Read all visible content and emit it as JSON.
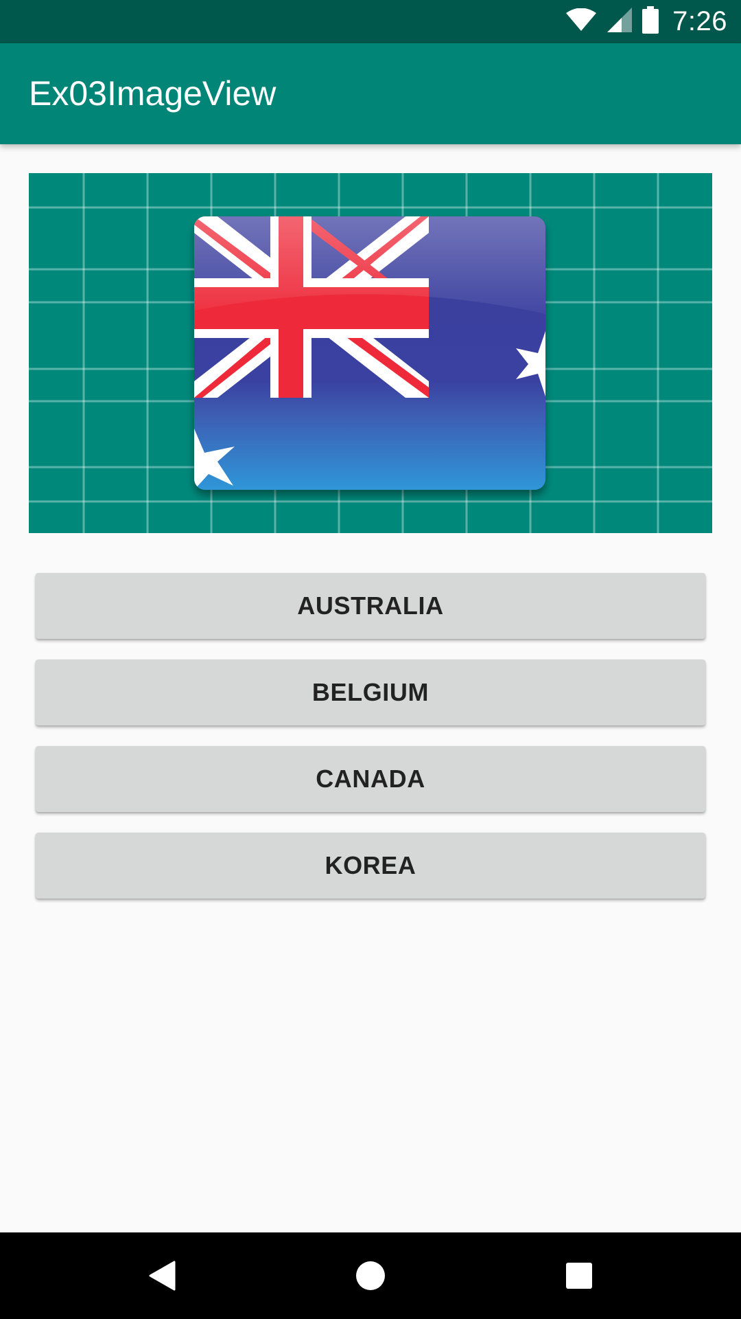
{
  "status_bar": {
    "time": "7:26",
    "icons": [
      "wifi-icon",
      "cellular-signal-icon",
      "battery-icon"
    ]
  },
  "app_bar": {
    "title": "Ex03ImageView"
  },
  "image_view": {
    "content": "australia-flag-image"
  },
  "buttons": [
    {
      "label": "AUSTRALIA"
    },
    {
      "label": "BELGIUM"
    },
    {
      "label": "CANADA"
    },
    {
      "label": "KOREA"
    }
  ],
  "nav_bar": {
    "icons": [
      "back-icon",
      "home-icon",
      "recents-icon"
    ]
  },
  "colors": {
    "status_bar": "#00574b",
    "app_bar": "#008577",
    "image_background": "#00897b",
    "button": "#d6d7d7",
    "page_background": "#fafafa"
  }
}
